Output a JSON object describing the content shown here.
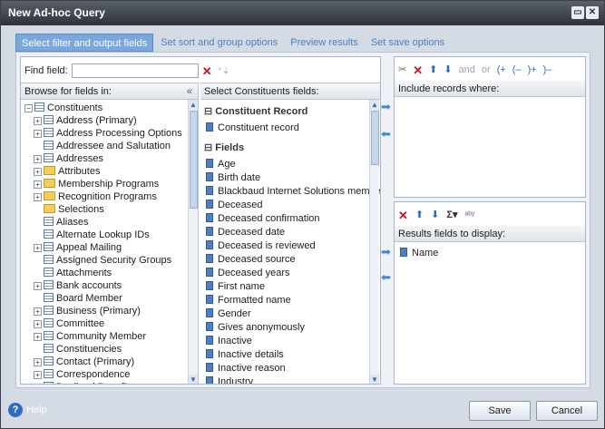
{
  "window": {
    "title": "New Ad-hoc Query"
  },
  "tabs": [
    "Select filter and output fields",
    "Set sort and group options",
    "Preview results",
    "Set save options"
  ],
  "find": {
    "label": "Find field:",
    "value": ""
  },
  "browse": {
    "header": "Browse for fields in:",
    "collapse": "«",
    "tree": [
      {
        "label": "Constituents",
        "exp": "⊟",
        "icon": "table"
      },
      {
        "label": "Address (Primary)",
        "exp": "⊞",
        "icon": "table"
      },
      {
        "label": "Address Processing Options",
        "exp": "⊞",
        "icon": "table"
      },
      {
        "label": "Addressee and Salutation",
        "exp": "",
        "icon": "table"
      },
      {
        "label": "Addresses",
        "exp": "⊞",
        "icon": "table"
      },
      {
        "label": "Attributes",
        "exp": "⊞",
        "icon": "folder"
      },
      {
        "label": "Membership Programs",
        "exp": "⊞",
        "icon": "folder"
      },
      {
        "label": "Recognition Programs",
        "exp": "⊞",
        "icon": "folder"
      },
      {
        "label": "Selections",
        "exp": "",
        "icon": "folder"
      },
      {
        "label": "Aliases",
        "exp": "",
        "icon": "table"
      },
      {
        "label": "Alternate Lookup IDs",
        "exp": "",
        "icon": "table"
      },
      {
        "label": "Appeal Mailing",
        "exp": "⊞",
        "icon": "table"
      },
      {
        "label": "Assigned Security Groups",
        "exp": "",
        "icon": "table"
      },
      {
        "label": "Attachments",
        "exp": "",
        "icon": "table"
      },
      {
        "label": "Bank accounts",
        "exp": "⊞",
        "icon": "table"
      },
      {
        "label": "Board Member",
        "exp": "",
        "icon": "table"
      },
      {
        "label": "Business (Primary)",
        "exp": "⊞",
        "icon": "table"
      },
      {
        "label": "Committee",
        "exp": "⊞",
        "icon": "table"
      },
      {
        "label": "Community Member",
        "exp": "⊞",
        "icon": "table"
      },
      {
        "label": "Constituencies",
        "exp": "",
        "icon": "table"
      },
      {
        "label": "Contact (Primary)",
        "exp": "⊞",
        "icon": "table"
      },
      {
        "label": "Correspondence",
        "exp": "⊞",
        "icon": "table"
      },
      {
        "label": "Declined Benefits",
        "exp": "⊞",
        "icon": "table"
      }
    ]
  },
  "select": {
    "header": "Select Constituents fields:",
    "record_section": "Constituent Record",
    "record_item": "Constituent record",
    "fields_section": "Fields",
    "fields": [
      "Age",
      "Birth date",
      "Blackbaud Internet Solutions member",
      "Deceased",
      "Deceased confirmation",
      "Deceased date",
      "Deceased is reviewed",
      "Deceased source",
      "Deceased years",
      "First name",
      "Formatted name",
      "Gender",
      "Gives anonymously",
      "Inactive",
      "Inactive details",
      "Inactive reason",
      "Industry"
    ]
  },
  "filter": {
    "header": "Include records where:",
    "toolbar": {
      "and": "and",
      "or": "or",
      "p1": "(+",
      "p2": "(–",
      "p3": ")+",
      "p4": ")–"
    }
  },
  "output": {
    "header": "Results fields to display:",
    "items": [
      "Name"
    ]
  },
  "footer": {
    "help": "Help",
    "save": "Save",
    "cancel": "Cancel"
  }
}
